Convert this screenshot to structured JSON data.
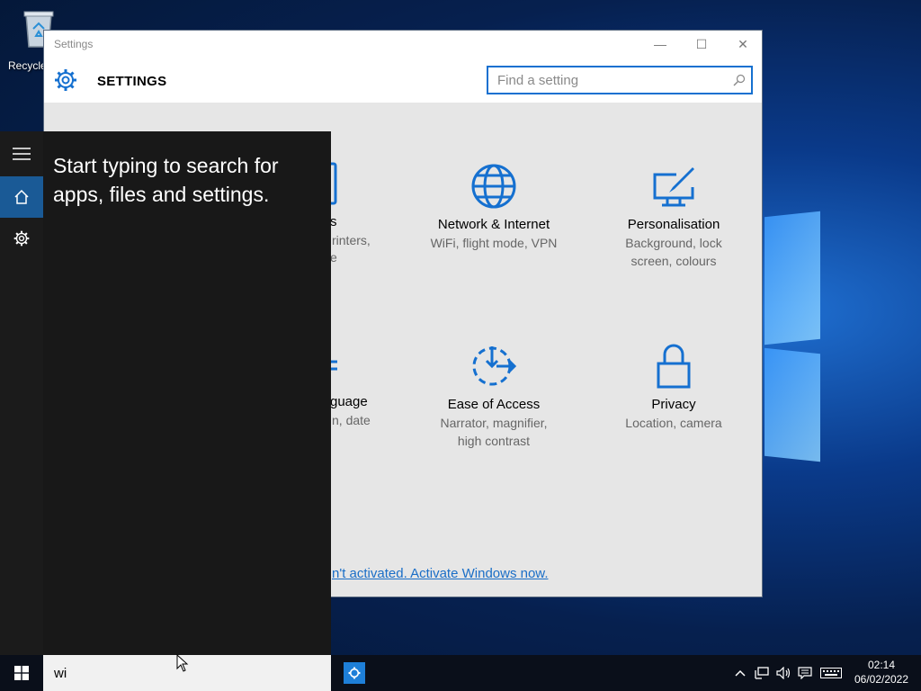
{
  "desktop": {
    "recycle_bin_label": "Recycle"
  },
  "settings_window": {
    "title": "Settings",
    "header_title": "SETTINGS",
    "search_placeholder": "Find a setting",
    "controls": {
      "minimize": "—",
      "maximize": "☐",
      "close": "✕"
    },
    "tiles": [
      {
        "name": "Network & Internet",
        "desc_line1": "WiFi, flight mode, VPN",
        "desc_line2": "",
        "icon": "globe-icon"
      },
      {
        "name": "Personalisation",
        "desc_line1": "Background, lock",
        "desc_line2": "screen, colours",
        "icon": "paintbrush-icon"
      },
      {
        "name": "Ease of Access",
        "desc_line1": "Narrator, magnifier,",
        "desc_line2": "high contrast",
        "icon": "ease-of-access-icon"
      },
      {
        "name": "Privacy",
        "desc_line1": "Location, camera",
        "desc_line2": "",
        "icon": "lock-icon"
      }
    ],
    "partial_tiles": {
      "devices_name": "s",
      "devices_desc1": "rinters,",
      "devices_desc2": "e",
      "time_name": "guage",
      "time_desc1": "n, date"
    },
    "activation_link": "n't activated. Activate Windows now.",
    "accent_color": "#1570d0"
  },
  "start_panel": {
    "hint": "Start typing to search for apps, files and settings.",
    "rail_items": [
      "hamburger-icon",
      "home-icon",
      "gear-icon"
    ]
  },
  "taskbar": {
    "search_value": "wi",
    "clock_time": "02:14",
    "clock_date": "06/02/2022",
    "tray_icons": [
      "chevron-up-icon",
      "network-icon",
      "volume-icon",
      "action-center-icon",
      "keyboard-icon"
    ]
  }
}
